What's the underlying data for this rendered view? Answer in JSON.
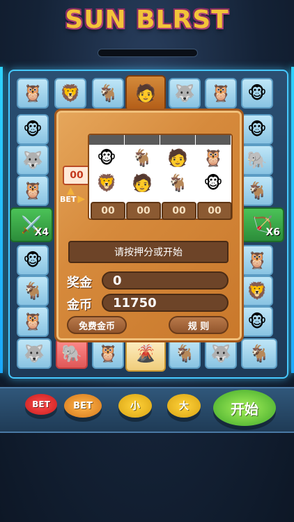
{
  "title": "SUN BLRST",
  "left_counter": "00",
  "bet_tag": "BET",
  "reel_bets": [
    "00",
    "00",
    "00",
    "00"
  ],
  "message": "请按押分或开始",
  "win": {
    "label": "奖金",
    "value": "0"
  },
  "coins": {
    "label": "金币",
    "value": "11750"
  },
  "free_coins_button": "免费金币",
  "rules_button": "规 则",
  "multipliers": {
    "left": "X4",
    "right": "X6"
  },
  "controls": {
    "bet_red": "BET",
    "bet_orange": "BET",
    "small": "小",
    "big": "大",
    "start": "开始"
  },
  "icons": {
    "owl": "🦉",
    "lion": "🦁",
    "goat": "🐐",
    "monkey": "🐵",
    "wolf": "🐺",
    "elephant": "🐘",
    "hero": "🧑",
    "volcano": "🌋",
    "swords": "⚔️",
    "bow": "🏹"
  }
}
